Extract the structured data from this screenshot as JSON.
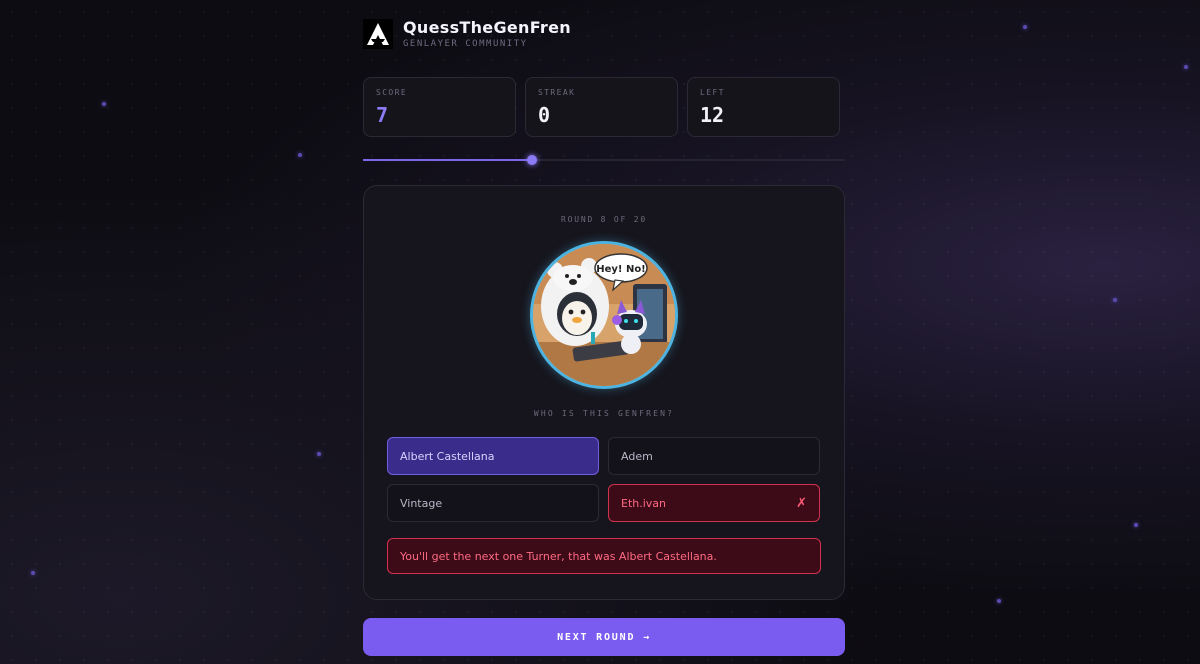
{
  "app": {
    "title": "QuessTheGenFren",
    "subtitle": "GENLAYER COMMUNITY"
  },
  "stats": [
    {
      "label": "SCORE",
      "value": "7",
      "accent": "#8b7cf6"
    },
    {
      "label": "STREAK",
      "value": "0"
    },
    {
      "label": "LEFT",
      "value": "12"
    }
  ],
  "progress": {
    "fraction": 0.35
  },
  "game": {
    "round_label": "ROUND 8 OF 20",
    "speech_bubble": "Hey! No!",
    "question": "WHO IS THIS GENFREN?",
    "options": [
      {
        "label": "Albert Castellana",
        "state": "correct"
      },
      {
        "label": "Adem",
        "state": "neutral"
      },
      {
        "label": "Vintage",
        "state": "neutral"
      },
      {
        "label": "Eth.ivan",
        "state": "wrong",
        "mark": "✗"
      }
    ],
    "feedback": "You'll get the next one Turner, that was Albert Castellana."
  },
  "next_button": {
    "label": "NEXT ROUND →"
  },
  "colors": {
    "accent": "#7b5cf0",
    "correct_bg": "#3a2c8a",
    "wrong_bg": "#3d0a18",
    "wrong_border": "#d1334f",
    "avatar_ring": "#4db3e0"
  },
  "icons": {
    "logo": "genlayer-triangle-logo",
    "avatar": "fren-avatar-illustration",
    "decor": "astronaut-robot-decoration"
  }
}
